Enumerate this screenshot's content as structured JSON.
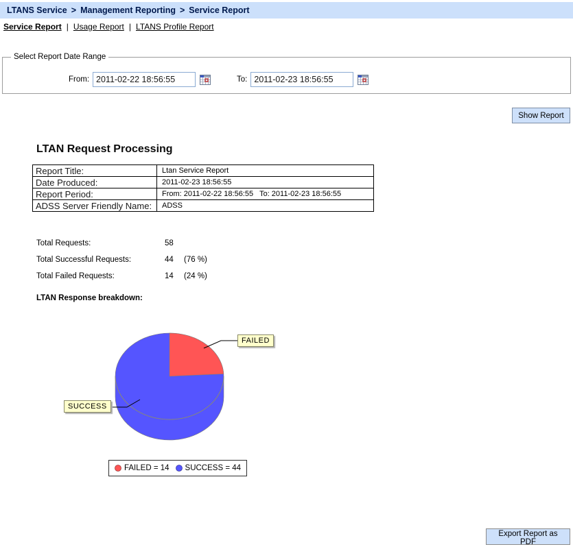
{
  "breadcrumb": {
    "separator": ">",
    "items": [
      "LTANS Service",
      "Management Reporting",
      "Service Report"
    ]
  },
  "tabs": {
    "separator": "|",
    "items": [
      {
        "label": "Service Report",
        "active": true
      },
      {
        "label": "Usage Report",
        "active": false
      },
      {
        "label": "LTANS Profile Report",
        "active": false
      }
    ]
  },
  "date_range": {
    "legend": "Select Report Date Range",
    "from_label": "From:",
    "from_value": "2011-02-22 18:56:55",
    "to_label": "To:",
    "to_value": "2011-02-23 18:56:55"
  },
  "actions": {
    "show_report": "Show Report",
    "export_pdf": "Export Report as PDF"
  },
  "report": {
    "heading": "LTAN Request Processing",
    "info_table": {
      "rows": [
        {
          "label": "Report Title:",
          "value": "Ltan Service Report"
        },
        {
          "label": "Date Produced:",
          "value": "2011-02-23 18:56:55"
        },
        {
          "label": "Report Period:",
          "value": "From: 2011-02-22 18:56:55   To: 2011-02-23 18:56:55"
        },
        {
          "label": "ADSS Server Friendly Name:",
          "value": "ADSS"
        }
      ]
    },
    "totals": {
      "rows": [
        {
          "label": "Total Requests:",
          "value": "58",
          "percent": ""
        },
        {
          "label": "Total Successful Requests:",
          "value": "44",
          "percent": "(76 %)"
        },
        {
          "label": "Total Failed Requests:",
          "value": "14",
          "percent": "(24 %)"
        }
      ]
    },
    "breakdown_label": "LTAN Response breakdown:"
  },
  "chart_data": {
    "type": "pie",
    "title": "LTAN Response breakdown",
    "total": 58,
    "slices": [
      {
        "label": "FAILED",
        "value": 14,
        "percent": 24,
        "color": "#ff5555"
      },
      {
        "label": "SUCCESS",
        "value": 44,
        "percent": 76,
        "color": "#5555ff"
      }
    ],
    "legend": [
      {
        "text": "FAILED = 14",
        "color": "#ff5555"
      },
      {
        "text": "SUCCESS = 44",
        "color": "#5555ff"
      }
    ],
    "style": "3d",
    "legend_position": "bottom"
  },
  "colors": {
    "topbar_bg": "#cce0fb",
    "button_bg": "#cde0fa",
    "callout_bg": "#ffffcc",
    "failed": "#ff5555",
    "success": "#5555ff"
  }
}
